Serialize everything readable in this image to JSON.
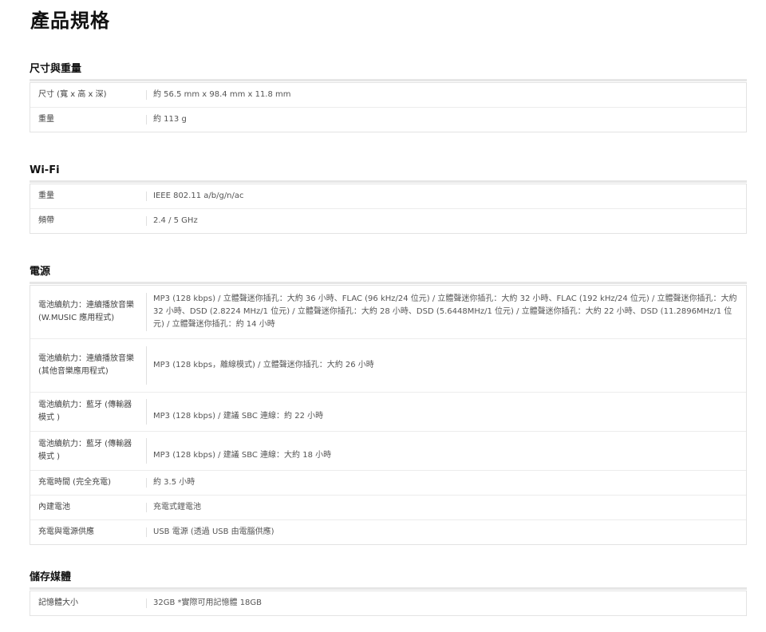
{
  "page_title": "產品規格",
  "sections": [
    {
      "heading": "尺寸與重量",
      "rows": [
        {
          "label": "尺寸 (寬 x 高 x 深)",
          "value": "約 56.5 mm x 98.4 mm x 11.8 mm"
        },
        {
          "label": "重量",
          "value": "約 113 g"
        }
      ]
    },
    {
      "heading": "Wi-Fi",
      "rows": [
        {
          "label": "重量",
          "value": "IEEE 802.11 a/b/g/n/ac"
        },
        {
          "label": "頻帶",
          "value": "2.4 / 5 GHz"
        }
      ]
    },
    {
      "heading": "電源",
      "rows": [
        {
          "label": "電池續航力：連續播放音樂 (W.MUSIC 應用程式)",
          "value": "MP3 (128 kbps) / 立體聲迷你插孔：大約 36 小時、FLAC (96 kHz/24 位元) / 立體聲迷你插孔：大約 32 小時、FLAC (192 kHz/24 位元) / 立體聲迷你插孔：大約 32 小時、DSD (2.8224 MHz/1 位元) / 立體聲迷你插孔：大約 28 小時、DSD (5.6448MHz/1 位元) / 立體聲迷你插孔：大約 22 小時、DSD (11.2896MHz/1 位元) / 立體聲迷你插孔：約 14 小時"
        },
        {
          "label": "電池續航力：連續播放音樂 (其他音樂應用程式)",
          "value": "MP3 (128 kbps，離線模式) / 立體聲迷你插孔：大約 26 小時"
        },
        {
          "label": "電池續航力：藍牙 (傳輸器模式 )",
          "value": "MP3 (128 kbps) / 建議 SBC 連線：約 22 小時"
        },
        {
          "label": "電池續航力：藍牙 (傳輸器模式 )",
          "value": "MP3 (128 kbps) / 建議 SBC 連線：大約 18 小時"
        },
        {
          "label": "充電時間 (完全充電)",
          "value": "約 3.5 小時"
        },
        {
          "label": "內建電池",
          "value": "充電式鋰電池"
        },
        {
          "label": "充電與電源供應",
          "value": "USB 電源 (透過 USB 由電腦供應)"
        }
      ]
    },
    {
      "heading": "儲存媒體",
      "rows": [
        {
          "label": "記憶體大小",
          "value": "32GB *實際可用記憶體 18GB"
        }
      ]
    }
  ]
}
